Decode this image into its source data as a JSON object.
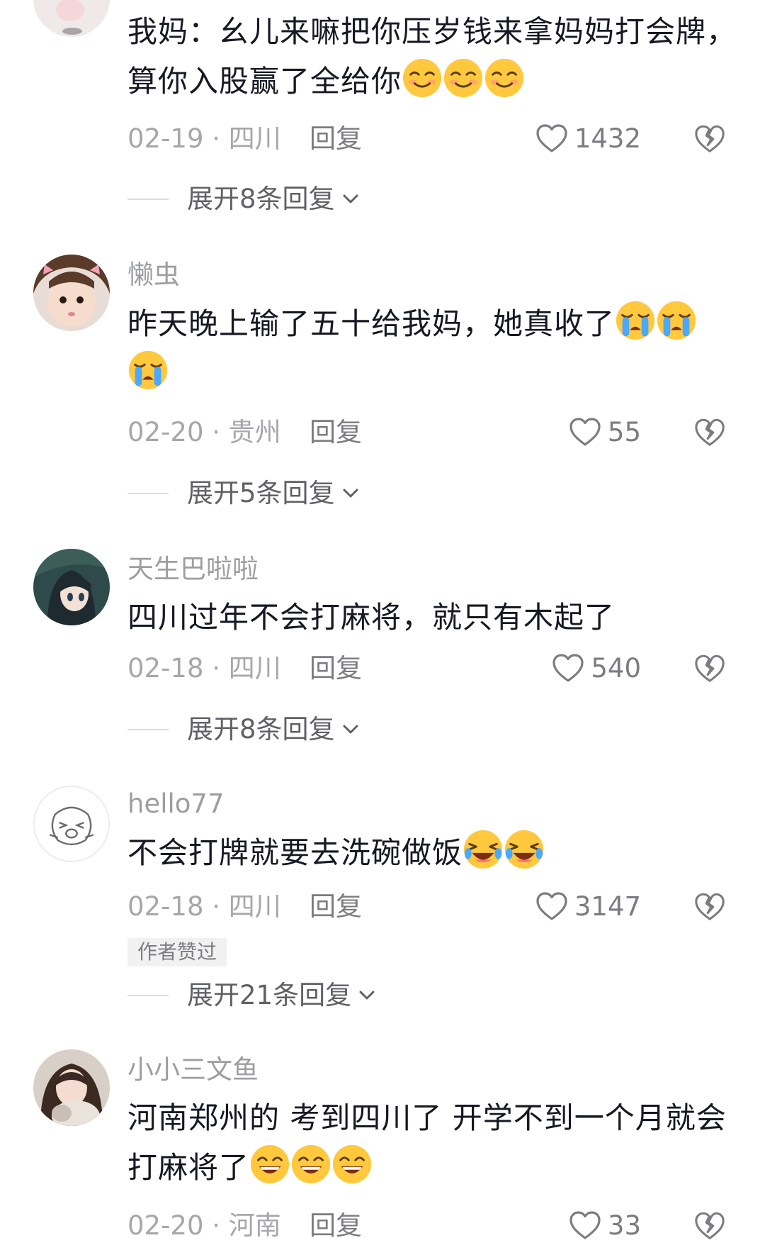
{
  "comments": [
    {
      "username": "",
      "text": "我妈：幺儿来嘛把你压岁钱来拿妈妈打会牌，算你入股赢了全给你",
      "emojis": [
        "smile-emoji",
        "smile-emoji",
        "smile-emoji"
      ],
      "date_location": "02-19 · 四川",
      "reply_label": "回复",
      "likes": "1432",
      "expand_label": "展开8条回复"
    },
    {
      "username": "懒虫",
      "text": "昨天晚上输了五十给我妈，她真收了",
      "emojis": [
        "crying-emoji",
        "crying-emoji",
        "crying-emoji"
      ],
      "date_location": "02-20 · 贵州",
      "reply_label": "回复",
      "likes": "55",
      "expand_label": "展开5条回复"
    },
    {
      "username": "天生巴啦啦",
      "text": "四川过年不会打麻将，就只有木起了",
      "emojis": [],
      "date_location": "02-18 · 四川",
      "reply_label": "回复",
      "likes": "540",
      "expand_label": "展开8条回复"
    },
    {
      "username": "hello77",
      "text": "不会打牌就要去洗碗做饭",
      "emojis": [
        "laugh-cry-emoji",
        "laugh-cry-emoji"
      ],
      "date_location": "02-18 · 四川",
      "reply_label": "回复",
      "likes": "3147",
      "badge": "作者赞过",
      "expand_label": "展开21条回复"
    },
    {
      "username": "小小三文鱼",
      "text": "河南郑州的 考到四川了 开学不到一个月就会打麻将了",
      "emojis": [
        "grin-emoji",
        "grin-emoji",
        "grin-emoji"
      ],
      "date_location": "02-20 · 河南",
      "reply_label": "回复",
      "likes": "33"
    }
  ],
  "colors": {
    "text": "#161823",
    "meta": "#a6a7ac",
    "username": "#9d9ea3",
    "emoji_face": "#ffc83d"
  }
}
